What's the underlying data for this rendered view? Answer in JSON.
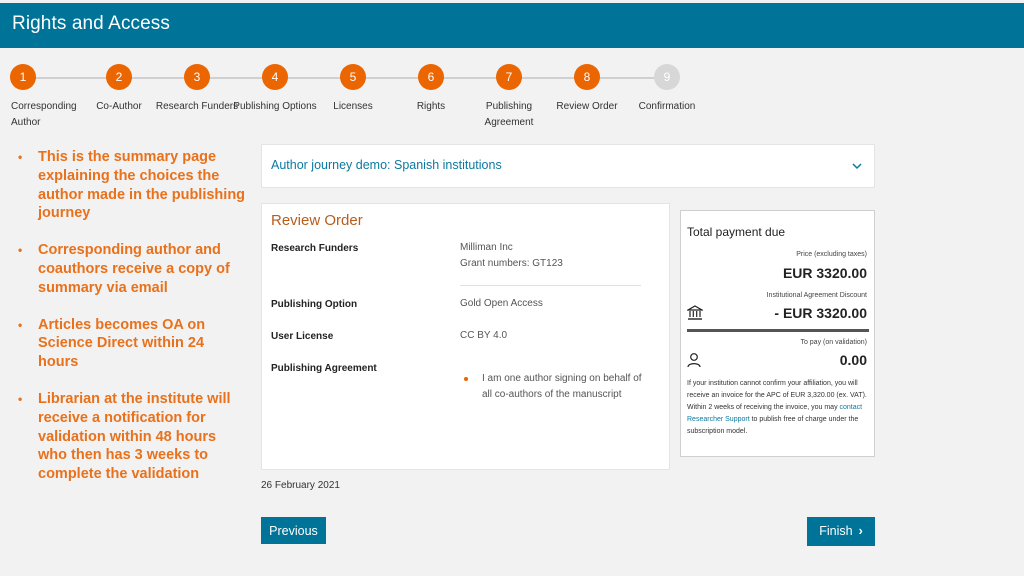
{
  "header": {
    "title": "Rights and Access"
  },
  "steps": [
    {
      "num": "1",
      "label": "Corresponding Author",
      "state": "done"
    },
    {
      "num": "2",
      "label": "Co-Author",
      "state": "done"
    },
    {
      "num": "3",
      "label": "Research Funders",
      "state": "done"
    },
    {
      "num": "4",
      "label": "Publishing Options",
      "state": "done"
    },
    {
      "num": "5",
      "label": "Licenses",
      "state": "done"
    },
    {
      "num": "6",
      "label": "Rights",
      "state": "done"
    },
    {
      "num": "7",
      "label": "Publishing Agreement",
      "state": "done"
    },
    {
      "num": "8",
      "label": "Review Order",
      "state": "current"
    },
    {
      "num": "9",
      "label": "Confirmation",
      "state": "pending"
    }
  ],
  "notes": [
    "This is the summary page explaining the choices the author made in the publishing journey",
    "Corresponding author and coauthors receive a copy of summary via email",
    "Articles becomes OA on Science Direct within 24 hours",
    "Librarian at the institute will receive a notification for validation within 48 hours who then has 3 weeks to complete the validation"
  ],
  "journey": {
    "title": "Author journey demo: Spanish institutions"
  },
  "review": {
    "title": "Review Order",
    "funders_label": "Research Funders",
    "funders_name": "Milliman Inc",
    "funders_grant": "Grant numbers: GT123",
    "option_label": "Publishing Option",
    "option_value": "Gold Open Access",
    "license_label": "User License",
    "license_value": "CC BY 4.0",
    "agreement_label": "Publishing Agreement",
    "agreement_value": "I am one author signing on behalf of all co-authors of the manuscript"
  },
  "date": "26 February 2021",
  "payment": {
    "title": "Total payment due",
    "price_label": "Price (excluding taxes)",
    "price_value": "EUR 3320.00",
    "discount_label": "Institutional Agreement Discount",
    "discount_value": "- EUR 3320.00",
    "pay_label": "To pay (on validation)",
    "pay_value": "0.00",
    "note_pre": "If your institution cannot confirm your affiliation, you will receive an invoice for the APC of EUR 3,320.00 (ex. VAT). Within 2 weeks of receiving the invoice, you may ",
    "note_link": "contact Researcher Support",
    "note_post": " to publish free of charge under the subscription model."
  },
  "buttons": {
    "previous": "Previous",
    "finish": "Finish"
  },
  "colors": {
    "brand": "#007398",
    "accent": "#eb6500",
    "notes": "#e9711c"
  }
}
